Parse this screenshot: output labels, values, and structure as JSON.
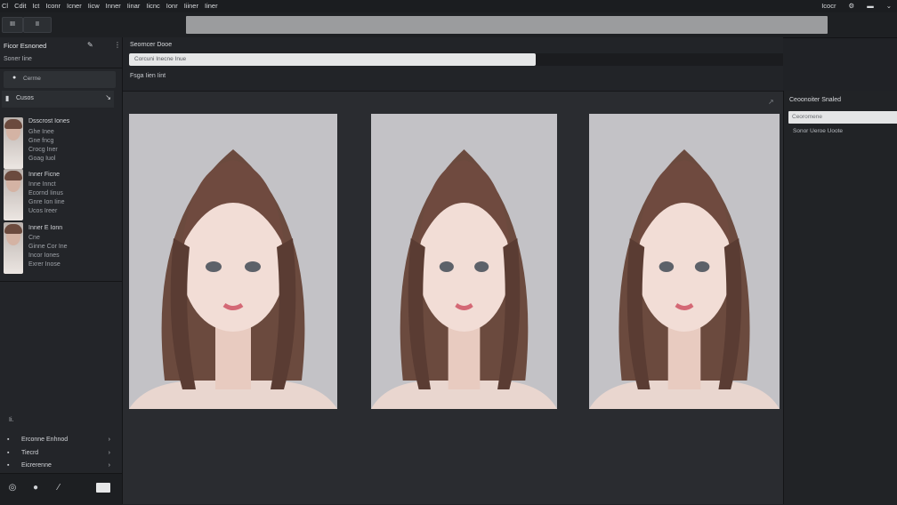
{
  "menubar": {
    "items": [
      "Cl",
      "Cdit",
      "Ict",
      "Iconr",
      "Icner",
      "Iicw",
      "Inner",
      "Iinar",
      "Iicnc",
      "Ionr",
      "Iiiner",
      "Iiner"
    ],
    "right_label": "Icocr",
    "right_icons": [
      "gear-icon",
      "minimize-icon",
      "chevron-down-icon"
    ]
  },
  "toolbar": {
    "btn1_label": "III",
    "btn2_label": "II"
  },
  "sidebar": {
    "title": "Ficor Esnoned",
    "subtitle": "Soner Iine",
    "search_placeholder": "Cerrne",
    "section_label": "Cusos",
    "threads": [
      {
        "title": "Dsscrost Iones",
        "lines": [
          "Ghe Inee",
          "Gne fncg",
          "Crocg Iner",
          "Goag Iuol"
        ]
      },
      {
        "title": "Inner Ficne",
        "lines": [
          "Inne Innct",
          "Ecornd Iinus",
          "Gnre Ion Iine",
          "Ucos Ireer"
        ]
      },
      {
        "title": "Inner E Ionn",
        "lines": [
          "Cne",
          "Ginne Cor Ine",
          "Incor Iones",
          "Exrer Inose"
        ]
      }
    ],
    "small_label": "Ii.",
    "footer_rows": [
      {
        "label": "Erconne Enhnod",
        "chevron": "›"
      },
      {
        "label": "Tiecrd",
        "chevron": "›"
      },
      {
        "label": "Eicrerenne",
        "chevron": "›"
      }
    ]
  },
  "main": {
    "title": "Seorncer Dooe",
    "prompt_value": "Corcuni Inecne Inue",
    "subtitle": "Fsga Iien Iint"
  },
  "right_panel": {
    "title": "Ceoonoiter Snaled",
    "field_value": "Ceoromene",
    "caption": "Sonor Ueroe Uoote"
  },
  "colors": {
    "background": "#202226",
    "panel": "#2a2c30",
    "hair": "#6b4a3e"
  }
}
